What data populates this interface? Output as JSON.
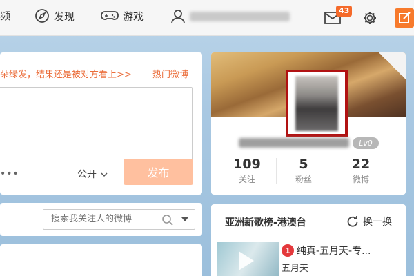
{
  "nav": {
    "home_partial": "频",
    "discover_label": "发现",
    "games_label": "游戏",
    "user_name": "",
    "message_badge": "43",
    "discover_icon": "compass-icon",
    "games_icon": "gamepad-icon",
    "user_icon": "user-icon",
    "mail_icon": "mail-icon",
    "settings_icon": "gear-icon",
    "edit_icon": "edit-icon"
  },
  "composer": {
    "promo_text": "朵绿发，结果还是被对方看上>>",
    "hot_link": "热门微博",
    "more": "•••",
    "visibility": "公开",
    "publish_label": "发布"
  },
  "search": {
    "placeholder": "搜索我关注人的微博"
  },
  "profile": {
    "level": "Lv0",
    "stats": [
      {
        "value": "109",
        "label": "关注"
      },
      {
        "value": "5",
        "label": "粉丝"
      },
      {
        "value": "22",
        "label": "微博"
      }
    ]
  },
  "music": {
    "title": "亚洲新歌榜-港澳台",
    "refresh_label": "换一换",
    "items": [
      {
        "rank": "1",
        "song": "纯真-五月天-专...",
        "artist": "五月天"
      }
    ]
  },
  "colors": {
    "accent": "#f77a2c",
    "promo": "#eb6d3a",
    "publish_disabled": "#ffc09f",
    "highlight_frame": "#b11212"
  }
}
